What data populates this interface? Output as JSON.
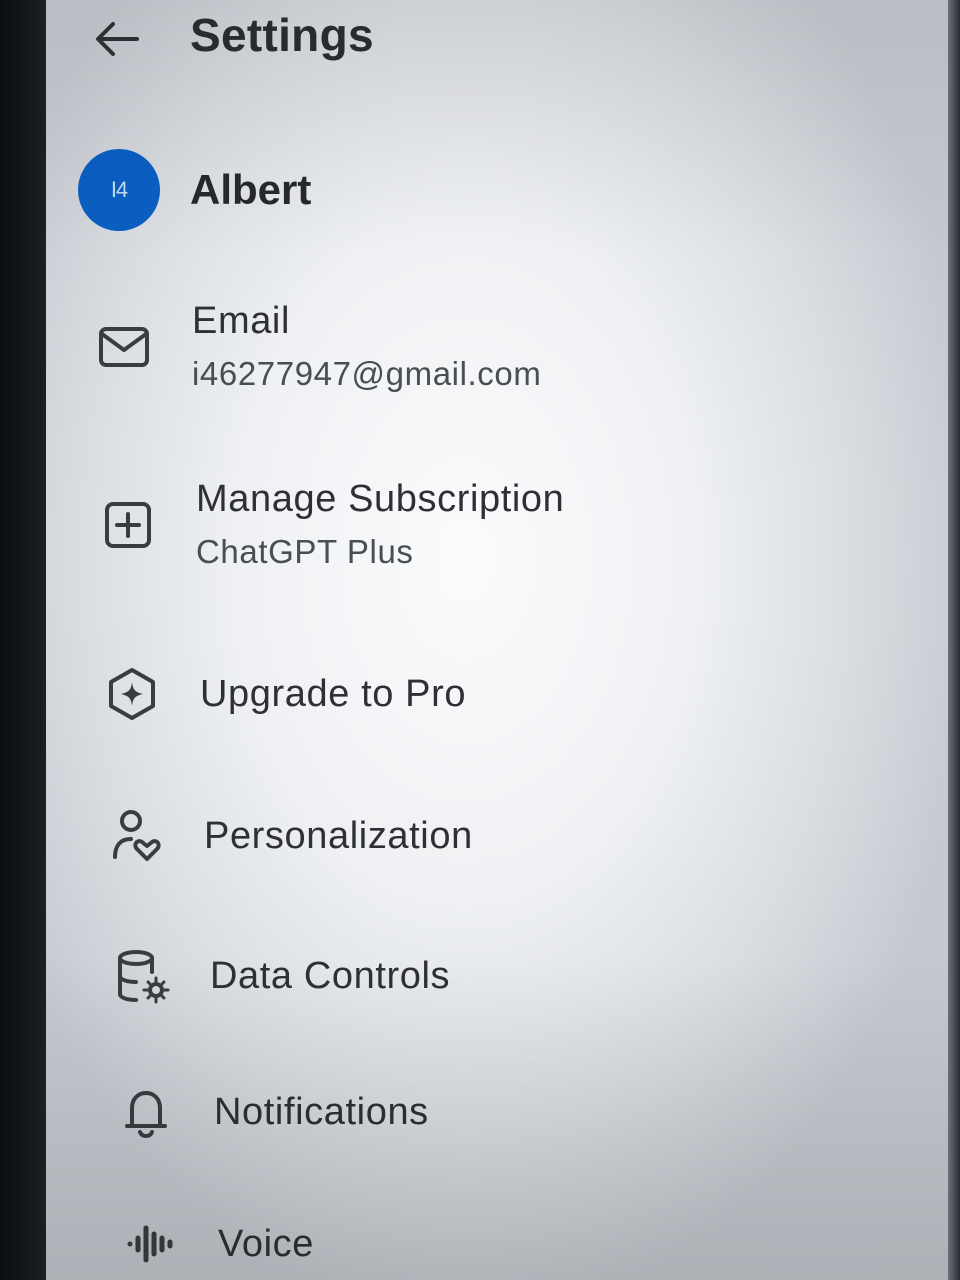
{
  "header": {
    "title": "Settings",
    "back_icon": "arrow-left-icon"
  },
  "profile": {
    "avatar_text": "I4",
    "avatar_color": "#0a5fc2",
    "name": "Albert"
  },
  "menu": {
    "email": {
      "label": "Email",
      "value": "i46277947@gmail.com",
      "icon": "envelope-icon"
    },
    "subscription": {
      "label": "Manage Subscription",
      "value": "ChatGPT Plus",
      "icon": "plus-square-icon"
    },
    "upgrade": {
      "label": "Upgrade to Pro",
      "icon": "sparkle-hexagon-icon"
    },
    "personalization": {
      "label": "Personalization",
      "icon": "person-heart-icon"
    },
    "data_controls": {
      "label": "Data Controls",
      "icon": "database-gear-icon"
    },
    "notifications": {
      "label": "Notifications",
      "icon": "bell-icon"
    },
    "voice": {
      "label": "Voice",
      "icon": "waveform-icon"
    }
  }
}
